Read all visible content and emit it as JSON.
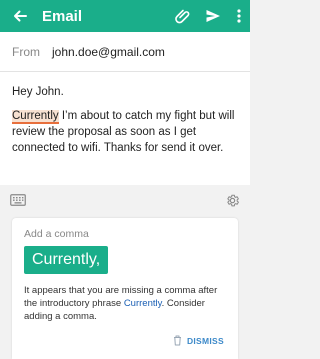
{
  "appbar": {
    "title": "Email",
    "back_icon": "arrow-left-icon",
    "attach_icon": "paperclip-icon",
    "send_icon": "send-icon",
    "menu_icon": "more-vertical-icon",
    "color": "#1aae8a"
  },
  "from": {
    "label": "From",
    "value": "john.doe@gmail.com"
  },
  "email_body": {
    "greeting": "Hey John.",
    "flagged_word": "Currently",
    "rest": " I’m about to catch my fight but will review the proposal as soon as I get connected to wifi. Thanks for send it over."
  },
  "keyboard_bar": {
    "keyboard_icon": "keyboard-icon",
    "settings_icon": "gear-icon"
  },
  "suggestion_card": {
    "caption": "Add a comma",
    "suggestion": "Currently,",
    "explanation_pre": "It appears that you are missing a comma after the introductory phrase ",
    "explanation_word": "Currently",
    "explanation_post": ". Consider adding a comma.",
    "dismiss_label": "DISMISS",
    "dismiss_icon": "trash-icon"
  }
}
